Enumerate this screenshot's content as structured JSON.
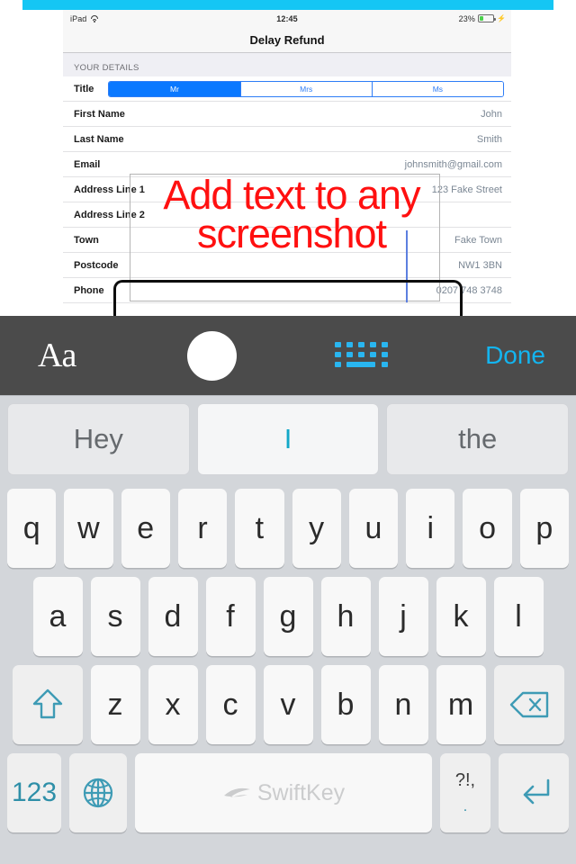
{
  "statusbar": {
    "device": "iPad",
    "wifi_icon": "wifi-icon",
    "time": "12:45",
    "battery_percent": "23%",
    "battery_icon": "battery-icon",
    "charging_icon": "lightning-bolt-icon"
  },
  "navbar": {
    "title": "Delay Refund"
  },
  "form": {
    "section_header": "YOUR DETAILS",
    "title_row": {
      "label": "Title",
      "options": [
        "Mr",
        "Mrs",
        "Ms"
      ],
      "selected": "Mr"
    },
    "rows": [
      {
        "label": "First Name",
        "value": "John"
      },
      {
        "label": "Last Name",
        "value": "Smith"
      },
      {
        "label": "Email",
        "value": "johnsmith@gmail.com"
      },
      {
        "label": "Address Line 1",
        "value": "123 Fake Street"
      },
      {
        "label": "Address Line 2",
        "value": ""
      },
      {
        "label": "Town",
        "value": "Fake Town"
      },
      {
        "label": "Postcode",
        "value": "NW1 3BN"
      },
      {
        "label": "Phone",
        "value": "0207 748 3748"
      }
    ]
  },
  "annotation": {
    "line1": "Add text to any",
    "line2": "screenshot",
    "color": "#FF1010",
    "caret_color": "#5C7FE0",
    "box_border_color": "#b4b4b4"
  },
  "toolbar": {
    "font_label": "Aa",
    "font_icon": "font-size-icon",
    "color_swatch": "#FFFFFF",
    "color_icon": "color-swatch-icon",
    "keyboard_icon": "keyboard-icon",
    "done_label": "Done",
    "accent": "#13B5F0",
    "background": "#4B4B4B"
  },
  "keyboard": {
    "predictions": [
      "Hey",
      "I",
      "the"
    ],
    "prediction_selected": "I",
    "row1": [
      "q",
      "w",
      "e",
      "r",
      "t",
      "y",
      "u",
      "i",
      "o",
      "p"
    ],
    "row2": [
      "a",
      "s",
      "d",
      "f",
      "g",
      "h",
      "j",
      "k",
      "l"
    ],
    "row3_letters": [
      "z",
      "x",
      "c",
      "v",
      "b",
      "n",
      "m"
    ],
    "shift_icon": "shift-arrow-icon",
    "backspace_icon": "backspace-icon",
    "numbers_label": "123",
    "globe_icon": "globe-icon",
    "space_brand": "SwiftKey",
    "space_icon": "swiftkey-logo-icon",
    "punct_top": "?!,",
    "punct_bottom": ".",
    "enter_icon": "return-arrow-icon",
    "accent": "#2E8FA8",
    "key_background": "#F8F8F8",
    "background": "#D3D6DA"
  },
  "banner": {
    "color": "#15C6F4"
  }
}
